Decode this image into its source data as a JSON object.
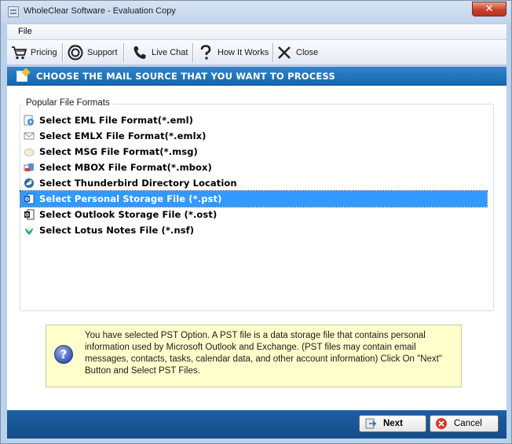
{
  "window": {
    "title": "WholeClear Software - Evaluation Copy",
    "close_glyph": "✕"
  },
  "menu": {
    "file": "File"
  },
  "toolbar": {
    "pricing": "Pricing",
    "support": "Support",
    "live_chat": "Live Chat",
    "how_it_works": "How It Works",
    "close": "Close"
  },
  "header": {
    "text": "CHOOSE THE MAIL SOURCE THAT YOU WANT TO PROCESS"
  },
  "formats": {
    "group_title": "Popular File Formats",
    "items": [
      {
        "label": "Select EML File Format(*.eml)",
        "icon": "eml-icon"
      },
      {
        "label": "Select EMLX File Format(*.emlx)",
        "icon": "emlx-icon"
      },
      {
        "label": "Select MSG File Format(*.msg)",
        "icon": "msg-icon"
      },
      {
        "label": "Select MBOX File Format(*.mbox)",
        "icon": "mbox-icon"
      },
      {
        "label": "Select Thunderbird Directory Location",
        "icon": "thunderbird-icon"
      },
      {
        "label": "Select Personal Storage File (*.pst)",
        "icon": "pst-icon",
        "selected": true
      },
      {
        "label": "Select Outlook Storage File (*.ost)",
        "icon": "ost-icon"
      },
      {
        "label": "Select Lotus Notes File (*.nsf)",
        "icon": "nsf-icon"
      }
    ]
  },
  "info": {
    "glyph": "?",
    "text": "You have selected PST Option. A PST file is a data storage file that contains personal information used by Microsoft Outlook and Exchange. (PST files may contain email messages, contacts, tasks, calendar data, and other account information) Click On \"Next\" Button and Select PST Files."
  },
  "footer": {
    "next": "Next",
    "cancel": "Cancel"
  },
  "colors": {
    "header_blue": "#1467b0",
    "selection": "#3399ff",
    "info_bg": "#ffffcc",
    "footer_blue": "#1c5fa3"
  }
}
